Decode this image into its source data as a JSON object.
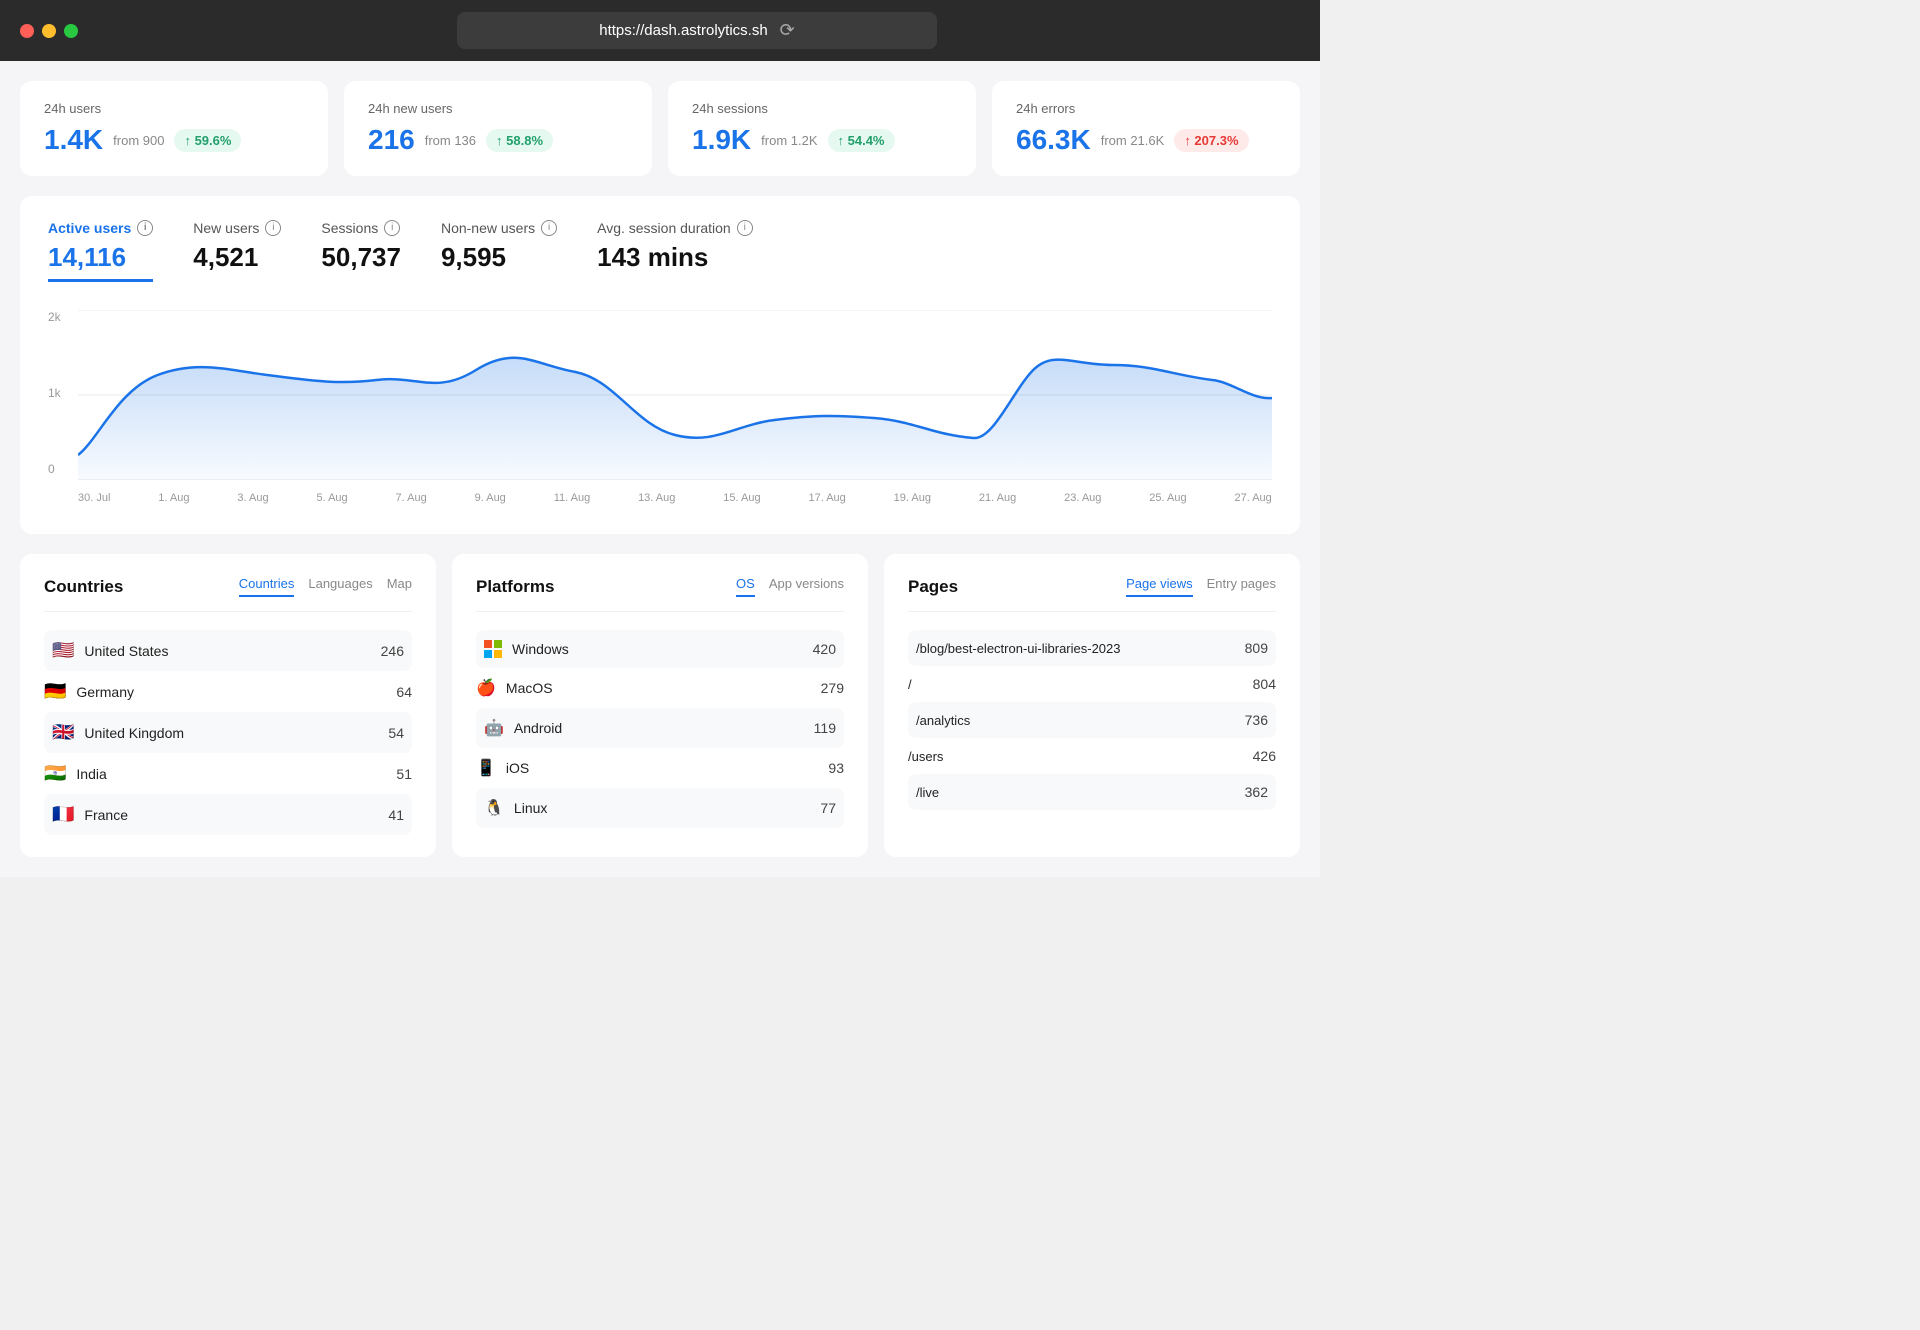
{
  "browser": {
    "url": "https://dash.astrolytics.sh",
    "reload_icon": "⟳"
  },
  "stats": [
    {
      "label": "24h users",
      "value": "1.4K",
      "from": "from 900",
      "badge": "↑ 59.6%",
      "badge_type": "green"
    },
    {
      "label": "24h new users",
      "value": "216",
      "from": "from 136",
      "badge": "↑ 58.8%",
      "badge_type": "green"
    },
    {
      "label": "24h sessions",
      "value": "1.9K",
      "from": "from 1.2K",
      "badge": "↑ 54.4%",
      "badge_type": "green"
    },
    {
      "label": "24h errors",
      "value": "66.3K",
      "from": "from 21.6K",
      "badge": "↑ 207.3%",
      "badge_type": "red"
    }
  ],
  "metrics": {
    "active_tab": 0,
    "tabs": [
      {
        "label": "Active users",
        "value": "14,116"
      },
      {
        "label": "New users",
        "value": "4,521"
      },
      {
        "label": "Sessions",
        "value": "50,737"
      },
      {
        "label": "Non-new users",
        "value": "9,595"
      },
      {
        "label": "Avg. session duration",
        "value": "143 mins"
      }
    ]
  },
  "chart": {
    "y_labels": [
      "2k",
      "1k",
      "0"
    ],
    "x_labels": [
      "30. Jul",
      "1. Aug",
      "3. Aug",
      "5. Aug",
      "7. Aug",
      "9. Aug",
      "11. Aug",
      "13. Aug",
      "15. Aug",
      "17. Aug",
      "19. Aug",
      "21. Aug",
      "23. Aug",
      "25. Aug",
      "27. Aug"
    ]
  },
  "countries": {
    "panel_title": "Countries",
    "tabs": [
      "Countries",
      "Languages",
      "Map"
    ],
    "active_tab": "Countries",
    "rows": [
      {
        "flag": "🇺🇸",
        "name": "United States",
        "value": "246"
      },
      {
        "flag": "🇩🇪",
        "name": "Germany",
        "value": "64"
      },
      {
        "flag": "🇬🇧",
        "name": "United Kingdom",
        "value": "54"
      },
      {
        "flag": "🇮🇳",
        "name": "India",
        "value": "51"
      },
      {
        "flag": "🇫🇷",
        "name": "France",
        "value": "41"
      }
    ]
  },
  "platforms": {
    "panel_title": "Platforms",
    "tabs": [
      "OS",
      "App versions"
    ],
    "active_tab": "OS",
    "rows": [
      {
        "icon": "⊞",
        "name": "Windows",
        "value": "420"
      },
      {
        "icon": "",
        "name": "MacOS",
        "value": "279"
      },
      {
        "icon": "🤖",
        "name": "Android",
        "value": "119"
      },
      {
        "icon": "",
        "name": "iOS",
        "value": "93"
      },
      {
        "icon": "🐧",
        "name": "Linux",
        "value": "77"
      }
    ]
  },
  "pages": {
    "panel_title": "Pages",
    "tabs": [
      "Page views",
      "Entry pages"
    ],
    "active_tab": "Page views",
    "rows": [
      {
        "name": "/blog/best-electron-ui-libraries-2023",
        "value": "809"
      },
      {
        "name": "/",
        "value": "804"
      },
      {
        "name": "/analytics",
        "value": "736"
      },
      {
        "name": "/users",
        "value": "426"
      },
      {
        "name": "/live",
        "value": "362"
      }
    ]
  }
}
